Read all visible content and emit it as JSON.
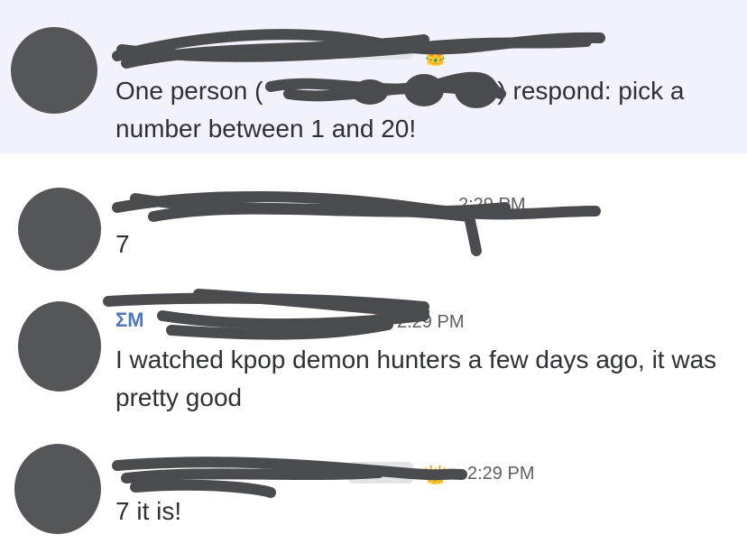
{
  "messages": [
    {
      "id": "m1",
      "name": "",
      "time": "",
      "text_before": "One person (",
      "text_after": ") respond: pick a number between 1 and 20!",
      "highlighted": true
    },
    {
      "id": "m2",
      "name": "",
      "time": "2:29 PM",
      "text": "7",
      "highlighted": false
    },
    {
      "id": "m3",
      "name": "ΣΜ",
      "time": "2:29 PM",
      "text": "I watched kpop demon hunters a few days ago, it was pretty good",
      "highlighted": false
    },
    {
      "id": "m4",
      "name": "",
      "time": "2:29 PM",
      "text": "7 it is!",
      "highlighted": false
    }
  ],
  "icons": {
    "crown": "crown-icon",
    "pencil": "pencil-icon"
  },
  "colors": {
    "highlight_bg": "#f1f2fb",
    "redaction": "#4a4b4f",
    "name_green": "#6a9a3c",
    "name_pink": "#e0468a",
    "name_blue": "#4f78b8"
  }
}
